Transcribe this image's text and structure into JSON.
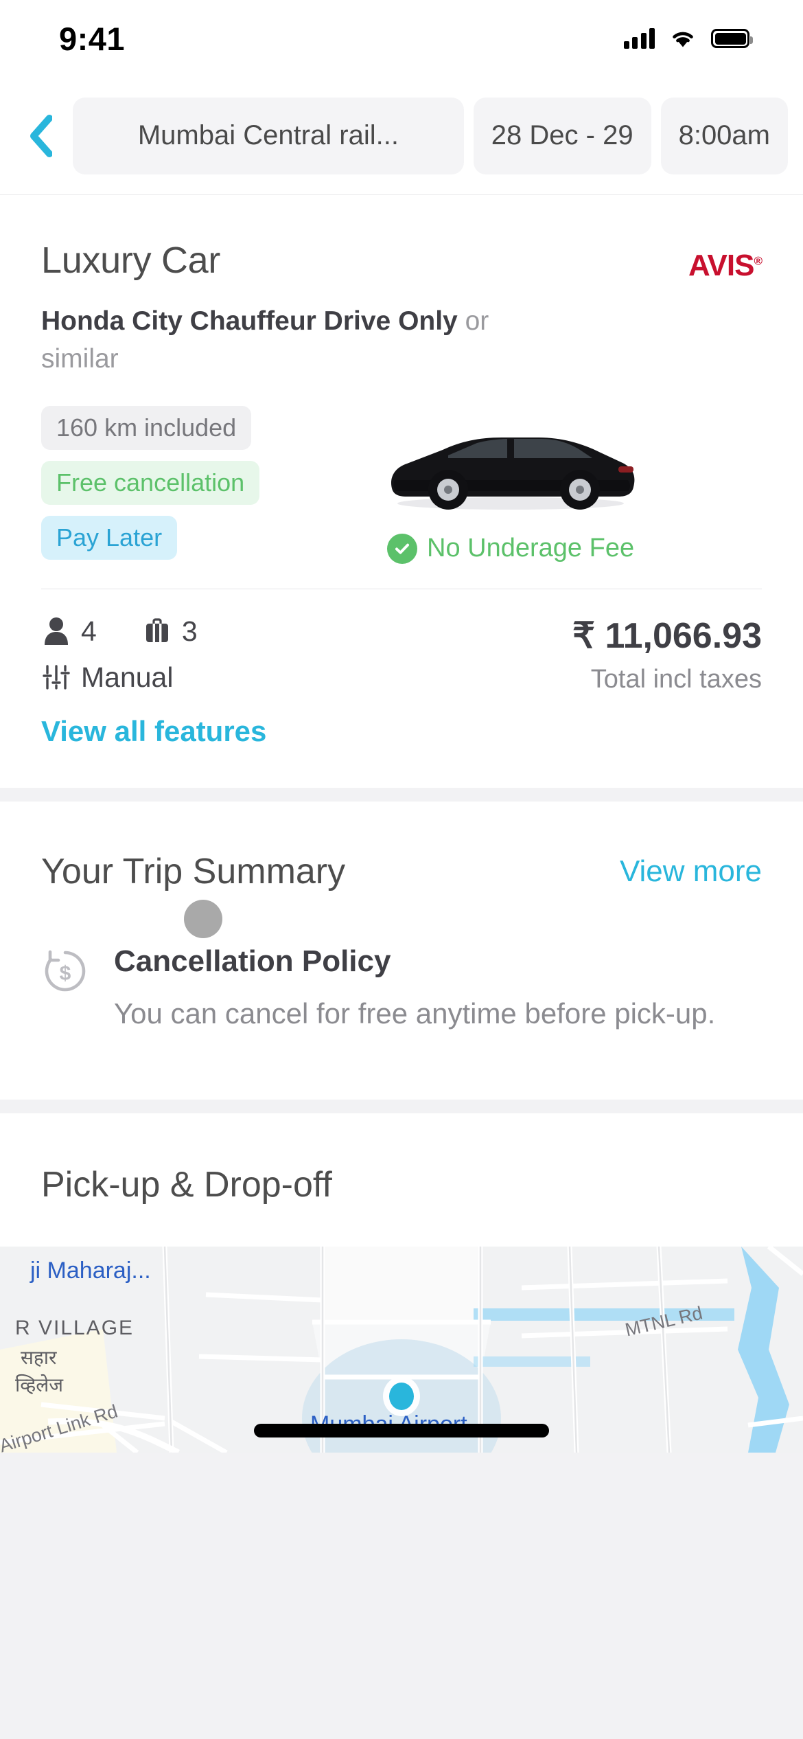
{
  "status_bar": {
    "time": "9:41",
    "cellular_icon": "signal-bars-icon",
    "wifi_icon": "wifi-icon",
    "battery_icon": "battery-icon"
  },
  "search_header": {
    "back_icon": "chevron-left-icon",
    "location": "Mumbai Central rail...",
    "dates": "28 Dec - 29",
    "time": "8:00am"
  },
  "car_card": {
    "title": "Luxury Car",
    "supplier": "AVIS",
    "supplier_trademark": "®",
    "model": "Honda City Chauffeur Drive Only",
    "model_suffix": " or similar",
    "chips": [
      {
        "label": "160 km included",
        "style": "neutral"
      },
      {
        "label": "Free cancellation",
        "style": "green"
      },
      {
        "label": "Pay Later",
        "style": "blue"
      }
    ],
    "underage": {
      "label": "No Underage Fee",
      "icon": "check-circle-icon"
    },
    "specs": {
      "passengers": "4",
      "passengers_icon": "person-icon",
      "bags": "3",
      "bags_icon": "suitcase-icon",
      "transmission": "Manual",
      "transmission_icon": "sliders-icon"
    },
    "price": {
      "amount": "₹ 11,066.93",
      "caption": "Total incl taxes"
    },
    "view_features": "View all features",
    "car_image_alt": "black-sedan-side-view"
  },
  "trip_summary": {
    "title": "Your Trip Summary",
    "view_more": "View more",
    "policy": {
      "icon": "refund-clock-icon",
      "title": "Cancellation Policy",
      "body": "You can cancel for free anytime before pick-up."
    }
  },
  "pickup": {
    "title": "Pick-up & Drop-off",
    "map": {
      "labels": {
        "poi": "ji Maharaj...",
        "village_en": "R VILLAGE",
        "village_hi_1": "सहार",
        "village_hi_2": "व्हिलेज",
        "road_left": "Airport Link Rd",
        "road_right": "MTNL Rd",
        "airport": "Mumbai Airport"
      },
      "marker_color": "#29b6dc",
      "marker_name": "pickup-location-marker"
    }
  },
  "colors": {
    "accent": "#29b6dc",
    "brand_avis": "#c8102e",
    "green": "#5cc16a",
    "text_dark": "#3f3f45",
    "text_muted": "#8b8b90"
  }
}
